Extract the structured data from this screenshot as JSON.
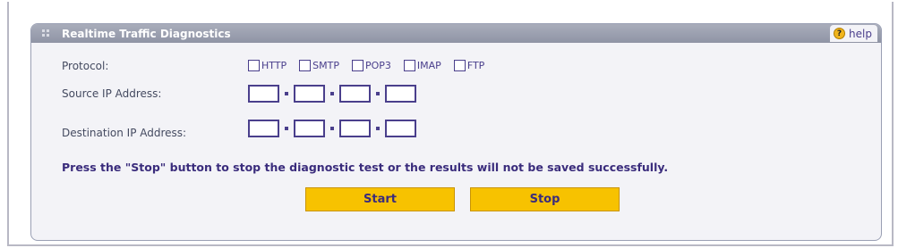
{
  "panel": {
    "title": "Realtime Traffic Diagnostics",
    "help_label": "help",
    "help_icon_glyph": "?"
  },
  "form": {
    "protocol_label": "Protocol:",
    "protocols": [
      "HTTP",
      "SMTP",
      "POP3",
      "IMAP",
      "FTP"
    ],
    "source_ip_label": "Source IP Address:",
    "source_ip": [
      "",
      "",
      "",
      ""
    ],
    "destination_ip_label": "Destination IP Address:",
    "destination_ip": [
      "",
      "",
      "",
      ""
    ]
  },
  "warning_text": "Press the \"Stop\" button to stop the diagnostic test or the results will not be saved successfully.",
  "buttons": {
    "start_label": "Start",
    "stop_label": "Stop"
  },
  "colors": {
    "header": "#9a9eae",
    "accent_text": "#3a2c7c",
    "button": "#f7c200"
  }
}
